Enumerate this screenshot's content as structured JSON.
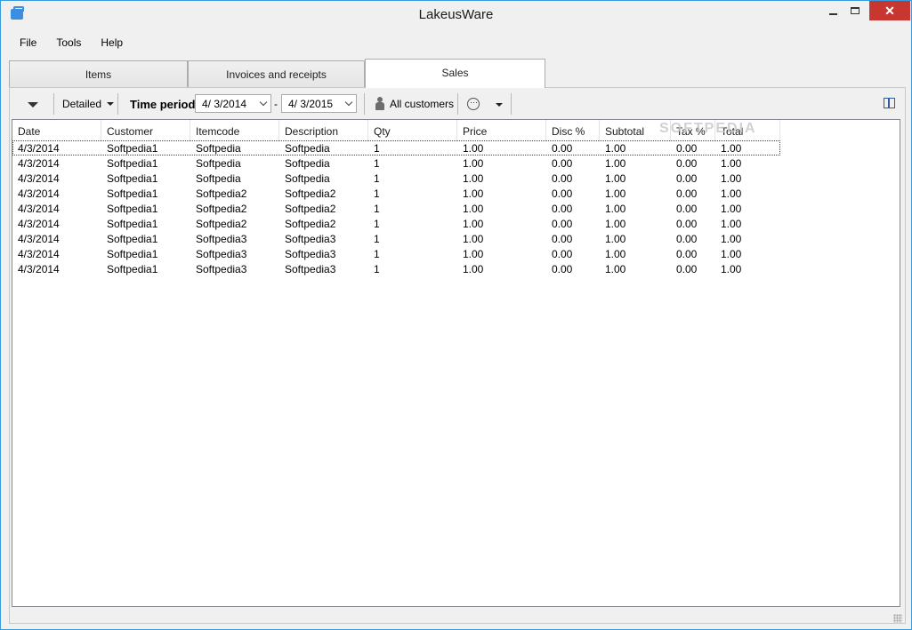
{
  "window": {
    "title": "LakeusWare"
  },
  "menu": [
    "File",
    "Tools",
    "Help"
  ],
  "tabs": [
    "Items",
    "Invoices and receipts",
    "Sales"
  ],
  "active_tab": "Sales",
  "toolbar": {
    "view_mode": "Detailed",
    "time_period_label": "Time period:",
    "date_from": "4/ 3/2014",
    "date_to": "4/ 3/2015",
    "date_separator": "-",
    "customers_label": "All customers",
    "more_icon": "⋯"
  },
  "grid": {
    "columns": [
      "Date",
      "Customer",
      "Itemcode",
      "Description",
      "Qty",
      "Price",
      "Disc %",
      "Subtotal",
      "Tax %",
      "Total"
    ],
    "rows": [
      [
        "4/3/2014",
        "Softpedia1",
        "Softpedia",
        "Softpedia",
        "1",
        "1.00",
        "0.00",
        "1.00",
        "0.00",
        "1.00"
      ],
      [
        "4/3/2014",
        "Softpedia1",
        "Softpedia",
        "Softpedia",
        "1",
        "1.00",
        "0.00",
        "1.00",
        "0.00",
        "1.00"
      ],
      [
        "4/3/2014",
        "Softpedia1",
        "Softpedia",
        "Softpedia",
        "1",
        "1.00",
        "0.00",
        "1.00",
        "0.00",
        "1.00"
      ],
      [
        "4/3/2014",
        "Softpedia1",
        "Softpedia2",
        "Softpedia2",
        "1",
        "1.00",
        "0.00",
        "1.00",
        "0.00",
        "1.00"
      ],
      [
        "4/3/2014",
        "Softpedia1",
        "Softpedia2",
        "Softpedia2",
        "1",
        "1.00",
        "0.00",
        "1.00",
        "0.00",
        "1.00"
      ],
      [
        "4/3/2014",
        "Softpedia1",
        "Softpedia2",
        "Softpedia2",
        "1",
        "1.00",
        "0.00",
        "1.00",
        "0.00",
        "1.00"
      ],
      [
        "4/3/2014",
        "Softpedia1",
        "Softpedia3",
        "Softpedia3",
        "1",
        "1.00",
        "0.00",
        "1.00",
        "0.00",
        "1.00"
      ],
      [
        "4/3/2014",
        "Softpedia1",
        "Softpedia3",
        "Softpedia3",
        "1",
        "1.00",
        "0.00",
        "1.00",
        "0.00",
        "1.00"
      ],
      [
        "4/3/2014",
        "Softpedia1",
        "Softpedia3",
        "Softpedia3",
        "1",
        "1.00",
        "0.00",
        "1.00",
        "0.00",
        "1.00"
      ]
    ],
    "focused_row": 0
  },
  "watermark": "SOFTPEDIA",
  "colors": {
    "window_border": "#3a9bdc",
    "close_button": "#c7372f",
    "accent_icon": "#3b8fe0"
  }
}
